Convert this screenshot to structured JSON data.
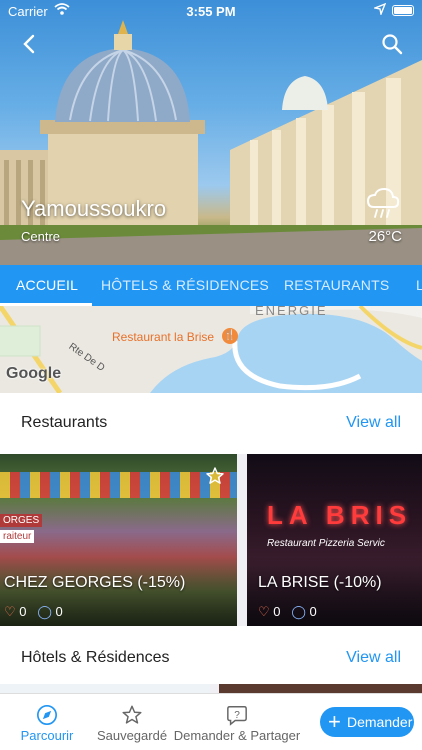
{
  "status": {
    "carrier": "Carrier",
    "time": "3:55 PM"
  },
  "city": {
    "name": "Yamoussoukro",
    "region": "Centre",
    "temperature": "26°C",
    "weather_icon": "cloud-rain-icon"
  },
  "tabs": [
    {
      "label": "ACCUEIL",
      "active": true
    },
    {
      "label": "HÔTELS & RÉSIDENCES",
      "active": false
    },
    {
      "label": "RESTAURANTS",
      "active": false
    },
    {
      "label": "L",
      "active": false
    }
  ],
  "map": {
    "area_label": "ENERGIE",
    "place_label": "Restaurant la Brise",
    "road_label": "Rte De D",
    "attribution": "Google"
  },
  "restaurants": {
    "title": "Restaurants",
    "view_all": "View all",
    "cards": [
      {
        "name": "CHEZ GEORGES (-15%)",
        "likes": "0",
        "comments": "0",
        "sign": "ORGES",
        "sign_sub": "raiteur"
      },
      {
        "name": "LA BRISE (-10%)",
        "likes": "0",
        "comments": "0",
        "sign": "LA BRIS",
        "sign_sub": "Restaurant Pizzeria Servic"
      }
    ]
  },
  "hotels": {
    "title": "Hôtels & Résidences",
    "view_all": "View all"
  },
  "bottom_nav": [
    {
      "label": "Parcourir",
      "active": true,
      "icon": "compass-icon"
    },
    {
      "label": "Sauvegardé",
      "active": false,
      "icon": "star-icon"
    },
    {
      "label": "Demander & Partager",
      "active": false,
      "icon": "question-bubble-icon"
    }
  ],
  "ask_button": {
    "label": "Demander",
    "icon": "plus-icon"
  },
  "colors": {
    "accent": "#2196f3",
    "map_pin": "#f28a3c"
  }
}
